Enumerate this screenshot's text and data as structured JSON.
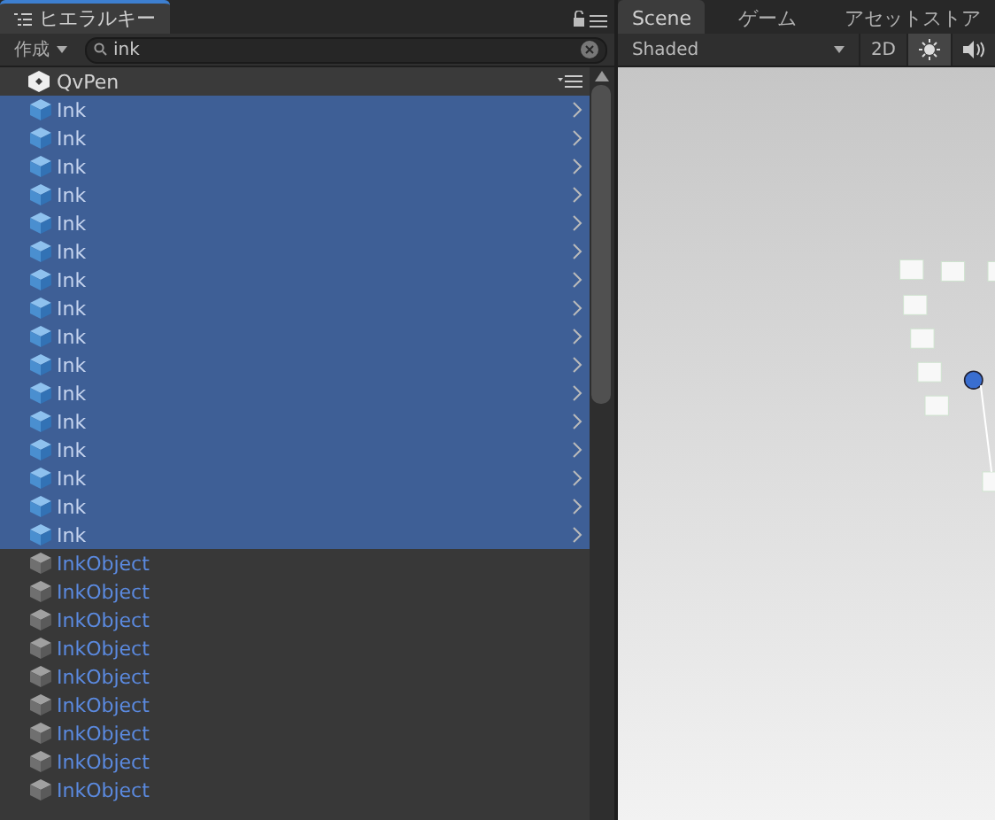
{
  "hierarchy": {
    "tab": "ヒエラルキー",
    "create": "作成",
    "search": {
      "value": "ink"
    },
    "scene_root": "QvPen",
    "items": [
      {
        "name": "Ink",
        "kind": "prefab",
        "selected": true
      },
      {
        "name": "Ink",
        "kind": "prefab",
        "selected": true
      },
      {
        "name": "Ink",
        "kind": "prefab",
        "selected": true
      },
      {
        "name": "Ink",
        "kind": "prefab",
        "selected": true
      },
      {
        "name": "Ink",
        "kind": "prefab",
        "selected": true
      },
      {
        "name": "Ink",
        "kind": "prefab",
        "selected": true
      },
      {
        "name": "Ink",
        "kind": "prefab",
        "selected": true
      },
      {
        "name": "Ink",
        "kind": "prefab",
        "selected": true
      },
      {
        "name": "Ink",
        "kind": "prefab",
        "selected": true
      },
      {
        "name": "Ink",
        "kind": "prefab",
        "selected": true
      },
      {
        "name": "Ink",
        "kind": "prefab",
        "selected": true
      },
      {
        "name": "Ink",
        "kind": "prefab",
        "selected": true
      },
      {
        "name": "Ink",
        "kind": "prefab",
        "selected": true
      },
      {
        "name": "Ink",
        "kind": "prefab",
        "selected": true
      },
      {
        "name": "Ink",
        "kind": "prefab",
        "selected": true
      },
      {
        "name": "Ink",
        "kind": "prefab",
        "selected": true
      },
      {
        "name": "InkObject",
        "kind": "object",
        "selected": false
      },
      {
        "name": "InkObject",
        "kind": "object",
        "selected": false
      },
      {
        "name": "InkObject",
        "kind": "object",
        "selected": false
      },
      {
        "name": "InkObject",
        "kind": "object",
        "selected": false
      },
      {
        "name": "InkObject",
        "kind": "object",
        "selected": false
      },
      {
        "name": "InkObject",
        "kind": "object",
        "selected": false
      },
      {
        "name": "InkObject",
        "kind": "object",
        "selected": false
      },
      {
        "name": "InkObject",
        "kind": "object",
        "selected": false
      },
      {
        "name": "InkObject",
        "kind": "object",
        "selected": false
      }
    ]
  },
  "scene": {
    "tabs": [
      {
        "label": "Scene",
        "selected": true
      },
      {
        "label": "ゲーム",
        "selected": false
      },
      {
        "label": "アセットストア",
        "selected": false
      }
    ],
    "shading": "Shaded",
    "mode_2d": "2D"
  }
}
